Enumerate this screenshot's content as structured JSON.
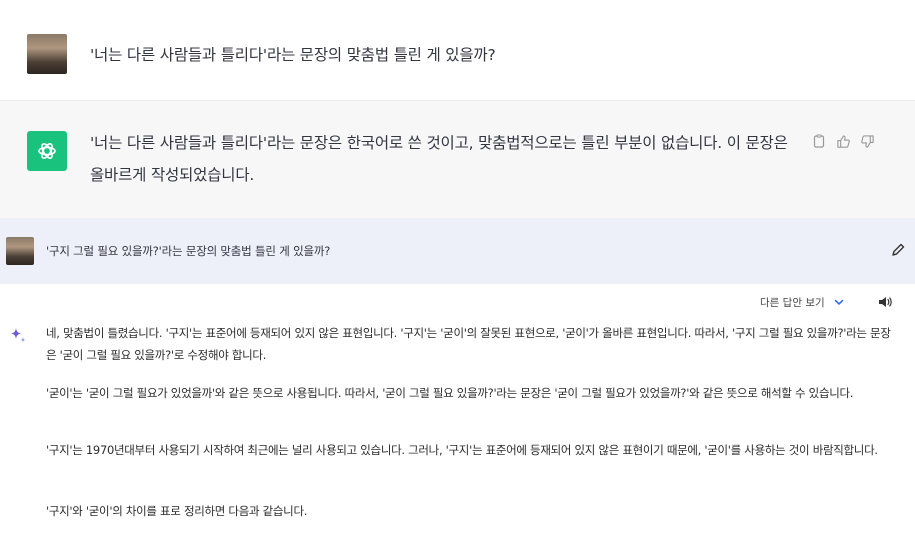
{
  "conversation": {
    "user_message_1": "'너는 다른 사람들과 틀리다'라는 문장의 맞춤법 틀린 게 있을까?",
    "assistant_message_1": "'너는 다른 사람들과 틀리다'라는 문장은 한국어로 쓴 것이고, 맞춤법적으로는 틀린 부분이 없습니다. 이 문장은 올바르게 작성되었습니다.",
    "user_message_2": "'구지 그럴 필요 있을까?'라는 문장의 맞춤법 틀린 게 있을까?",
    "assistant_message_2": {
      "toolbar_label": "다른 답안 보기",
      "paragraphs": [
        "네, 맞춤법이 틀렸습니다. '구지'는 표준어에 등재되어 있지 않은 표현입니다. '구지'는 '굳이'의 잘못된 표현으로, '굳이'가 올바른 표현입니다. 따라서, '구지 그럴 필요 있을까?'라는 문장은 '굳이 그럴 필요 있을까?'로 수정해야 합니다.",
        "'굳이'는 '굳이 그럴 필요가 있었을까'와 같은 뜻으로 사용됩니다. 따라서, '굳이 그럴 필요 있을까?'라는 문장은 '굳이 그럴 필요가 있었을까?'와 같은 뜻으로 해석할 수 있습니다.",
        "'구지'는 1970년대부터 사용되기 시작하여 최근에는 널리 사용되고 있습니다. 그러나, '구지'는 표준어에 등재되어 있지 않은 표현이기 때문에, '굳이'를 사용하는 것이 바람직합니다.",
        "'구지'와 '굳이'의 차이를 표로 정리하면 다음과 같습니다."
      ]
    }
  },
  "icons": {
    "gpt_logo": "openai-logo-icon",
    "copy": "copy-icon",
    "thumbs_up": "thumbs-up-icon",
    "thumbs_down": "thumbs-down-icon",
    "edit": "pencil-icon",
    "chevron": "chevron-down-icon",
    "speaker": "speaker-icon",
    "sparkle": "sparkle-icon"
  },
  "colors": {
    "gpt_green": "#19c37d",
    "accent_blue": "#2563eb",
    "sparkle_purple": "#6b5bd6"
  }
}
